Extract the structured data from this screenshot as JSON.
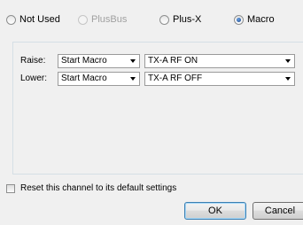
{
  "mode_options": [
    {
      "label": "Not Used",
      "checked": false,
      "disabled": false
    },
    {
      "label": "PlusBus",
      "checked": false,
      "disabled": true
    },
    {
      "label": "Plus-X",
      "checked": false,
      "disabled": false
    },
    {
      "label": "Macro",
      "checked": true,
      "disabled": false
    }
  ],
  "macro": {
    "raise": {
      "label": "Raise:",
      "action": "Start Macro",
      "macro": "TX-A RF ON"
    },
    "lower": {
      "label": "Lower:",
      "action": "Start Macro",
      "macro": "TX-A RF OFF"
    }
  },
  "reset": {
    "label": "Reset this channel to its default settings",
    "checked": false
  },
  "buttons": {
    "ok_label": "OK",
    "cancel_label": "Cancel"
  }
}
